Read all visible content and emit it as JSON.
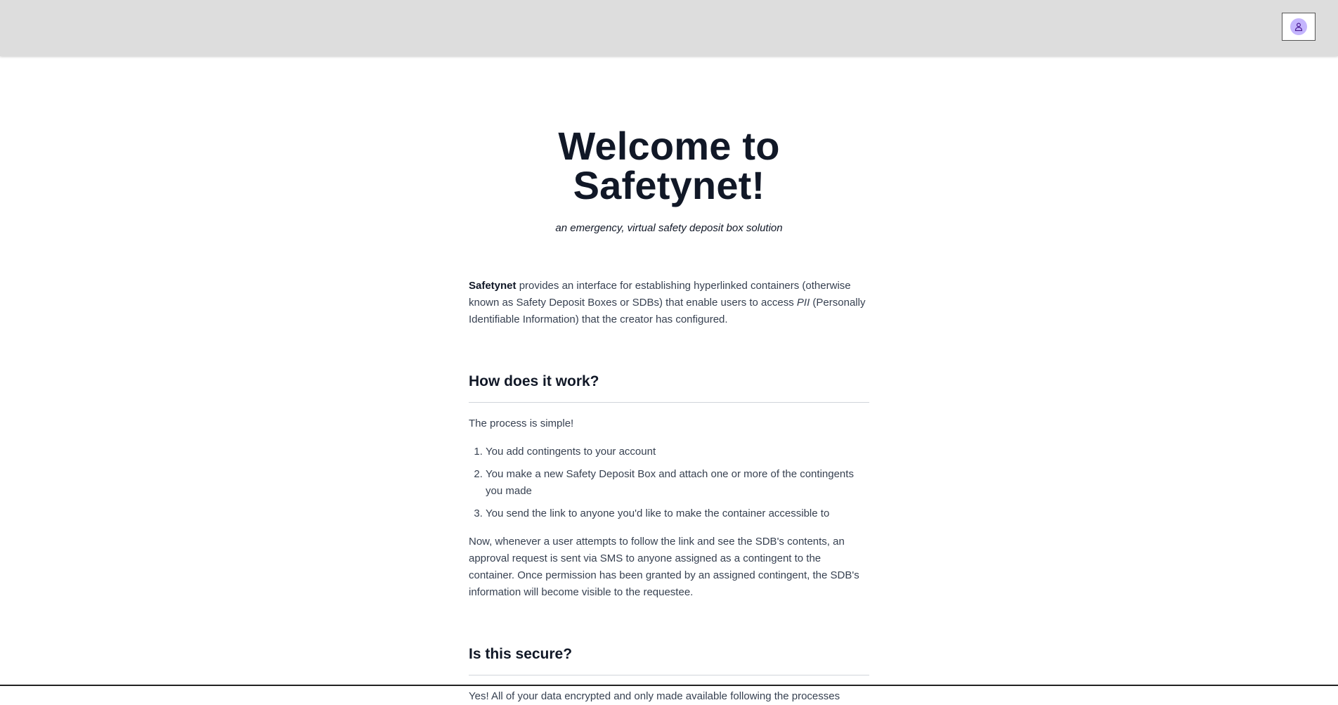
{
  "header": {
    "user_icon": "user-icon",
    "colors": {
      "bar": "#dddddd",
      "avatar": "#c4b5fd"
    }
  },
  "hero": {
    "title": "Welcome to Safetynet!",
    "subtitle": "an emergency, virtual safety deposit box solution"
  },
  "intro": {
    "brand": "Safetynet",
    "text_1": " provides an interface for establishing hyperlinked containers (otherwise known as Safety Deposit Boxes or SDBs) that enable users to access ",
    "pii": "PII",
    "text_2": " (Personally Identifiable Information) that the creator has configured."
  },
  "how": {
    "heading": "How does it work?",
    "lead": "The process is simple!",
    "steps": [
      "You add contingents to your account",
      "You make a new Safety Deposit Box and attach one or more of the contingents you made",
      "You send the link to anyone you'd like to make the container accessible to"
    ],
    "summary": "Now, whenever a user attempts to follow the link and see the SDB's contents, an approval request is sent via SMS to anyone assigned as a contingent to the container. Once permission has been granted by an assigned contingent, the SDB's information will become visible to the requestee."
  },
  "secure": {
    "heading": "Is this secure?",
    "text": "Yes! All of your data encrypted and only made available following the processes"
  }
}
